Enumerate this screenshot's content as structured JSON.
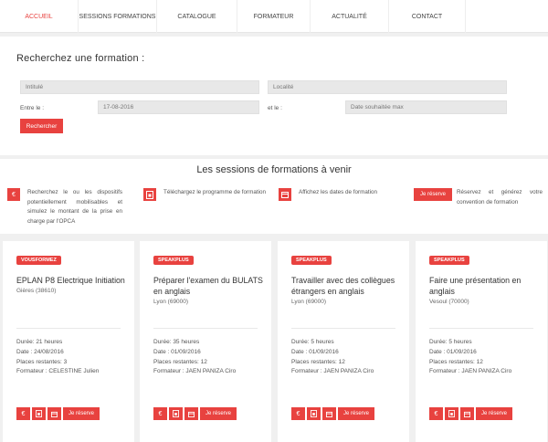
{
  "nav": {
    "items": [
      {
        "label": "Accueil",
        "active": true
      },
      {
        "label": "Sessions formations"
      },
      {
        "label": "Catalogue"
      },
      {
        "label": "Formateur"
      },
      {
        "label": "Actualité"
      },
      {
        "label": "Contact"
      }
    ]
  },
  "search": {
    "title": "Recherchez une formation :",
    "intitule_placeholder": "Intitulé",
    "localite_placeholder": "Localité",
    "entre_label": "Entre le :",
    "date_value": "17-08-2016",
    "et_label": "et le :",
    "date_max_placeholder": "Date souhaitée max",
    "button_label": "Rechercher"
  },
  "sessions": {
    "title": "Les sessions de formations à venir",
    "features": [
      {
        "icon": "euro-icon",
        "text": "Recherchez le ou les dispositifs potentiellement mobilisables et simulez le montant de la prise en charge par l'OPCA"
      },
      {
        "icon": "download-file-icon",
        "text": "Téléchargez le programme de formation"
      },
      {
        "icon": "calendar-icon",
        "text": "Affichez les dates de formation"
      },
      {
        "icon": "reserve-button",
        "button": "Je réserve",
        "text": "Réservez et générez votre convention de formation"
      }
    ]
  },
  "cards": [
    {
      "badge": "VOUSFORMEZ",
      "title": "EPLAN P8 Electrique Initiation",
      "location": "Gières (38610)",
      "duree": "Durée: 21 heures",
      "date": "Date : 24/08/2016",
      "places": "Places restantes: 3",
      "formateur": "Formateur : CELESTINE Julien",
      "reserve": "Je réserve"
    },
    {
      "badge": "SPEAKPLUS",
      "title": "Préparer l'examen du BULATS en anglais",
      "location": "Lyon (69000)",
      "duree": "Durée: 35 heures",
      "date": "Date : 01/09/2016",
      "places": "Places restantes: 12",
      "formateur": "Formateur : JAEN PANIZA Ciro",
      "reserve": "Je réserve"
    },
    {
      "badge": "SPEAKPLUS",
      "title": "Travailler avec des collègues étrangers en anglais",
      "location": "Lyon (69000)",
      "duree": "Durée: 5 heures",
      "date": "Date : 01/09/2016",
      "places": "Places restantes: 12",
      "formateur": "Formateur : JAEN PANIZA Ciro",
      "reserve": "Je réserve"
    },
    {
      "badge": "SPEAKPLUS",
      "title": "Faire une présentation en anglais",
      "location": "Vesoul (70000)",
      "duree": "Durée: 5 heures",
      "date": "Date : 01/09/2016",
      "places": "Places restantes: 12",
      "formateur": "Formateur : JAEN PANIZA Ciro",
      "reserve": "Je réserve"
    }
  ],
  "colors": {
    "accent": "#e8423f",
    "background": "#f0f0f0"
  }
}
